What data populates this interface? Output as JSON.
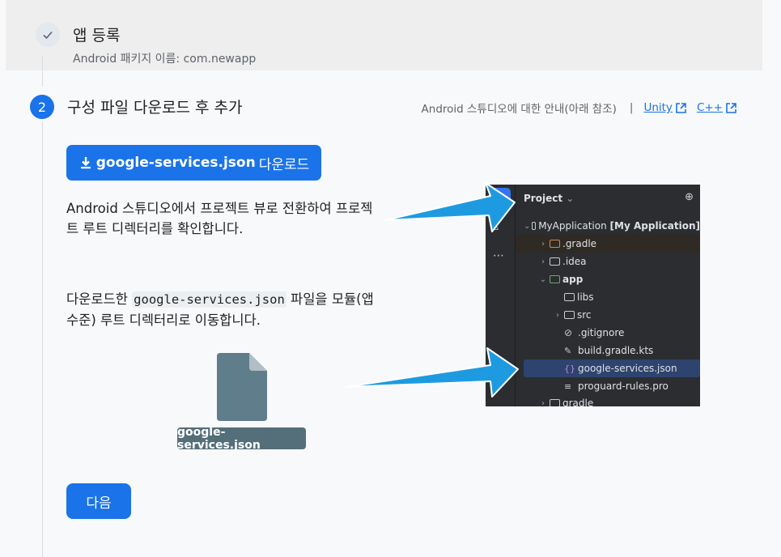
{
  "step1": {
    "title": "앱 등록",
    "subtitle": "Android 패키지 이름: com.newapp"
  },
  "step2": {
    "number": "2",
    "title": "구성 파일 다운로드 후 추가",
    "guide_text": "Android 스튜디오에 대한 안내(아래 참조)",
    "separator": "|",
    "links": [
      "Unity",
      "C++"
    ],
    "download_button": {
      "bold": "google-services.json",
      "rest": "다운로드"
    },
    "instruction1": "Android 스튜디오에서 프로젝트 뷰로 전환하여 프로젝트 루트 디렉터리를 확인합니다.",
    "instruction2_before": "다운로드한 ",
    "instruction2_code": "google-services.json",
    "instruction2_after": " 파일을 모듈(앱 수준) 루트 디렉터리로 이동합니다.",
    "file_label": "google-services.json",
    "next_button": "다음"
  },
  "ide": {
    "header": "Project",
    "rows": [
      {
        "label": "MyApplication",
        "suffix": "[My Application]"
      },
      {
        "label": ".gradle"
      },
      {
        "label": ".idea"
      },
      {
        "label": "app"
      },
      {
        "label": "libs"
      },
      {
        "label": "src"
      },
      {
        "label": ".gitignore"
      },
      {
        "label": "build.gradle.kts"
      },
      {
        "label": "google-services.json"
      },
      {
        "label": "proguard-rules.pro"
      },
      {
        "label": "gradle"
      }
    ]
  },
  "colors": {
    "primary": "#1a73e8",
    "file_label_bg": "#546e7a",
    "ide_bg": "#2b2d30",
    "arrow": "#1e9be0"
  }
}
